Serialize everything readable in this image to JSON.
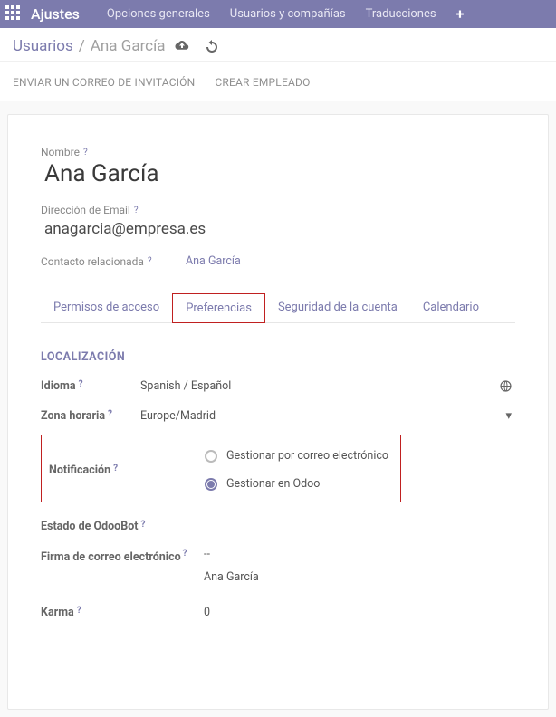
{
  "topbar": {
    "brand": "Ajustes",
    "menu": [
      "Opciones generales",
      "Usuarios y compañías",
      "Traducciones"
    ]
  },
  "breadcrumb": {
    "parent": "Usuarios",
    "current": "Ana García"
  },
  "actions": {
    "send_invite": "ENVIAR UN CORREO DE INVITACIÓN",
    "create_employee": "CREAR EMPLEADO"
  },
  "form": {
    "name_label": "Nombre",
    "name_value": "Ana García",
    "email_label": "Dirección de Email",
    "email_value": "anagarcia@empresa.es",
    "related_contact_label": "Contacto relacionada",
    "related_contact_value": "Ana García"
  },
  "tabs": {
    "items": [
      "Permisos de acceso",
      "Preferencias",
      "Seguridad de la cuenta",
      "Calendario"
    ],
    "active_index": 1
  },
  "localization": {
    "section_title": "LOCALIZACIÓN",
    "language_label": "Idioma",
    "language_value": "Spanish / Español",
    "timezone_label": "Zona horaria",
    "timezone_value": "Europe/Madrid",
    "notification_label": "Notificación",
    "notification_options": [
      "Gestionar por correo electrónico",
      "Gestionar en Odoo"
    ],
    "notification_selected_index": 1,
    "odoobot_label": "Estado de OdooBot",
    "signature_label": "Firma de correo electrónico",
    "signature_value_1": "--",
    "signature_value_2": "Ana García",
    "karma_label": "Karma",
    "karma_value": "0"
  },
  "help_glyph": "?"
}
